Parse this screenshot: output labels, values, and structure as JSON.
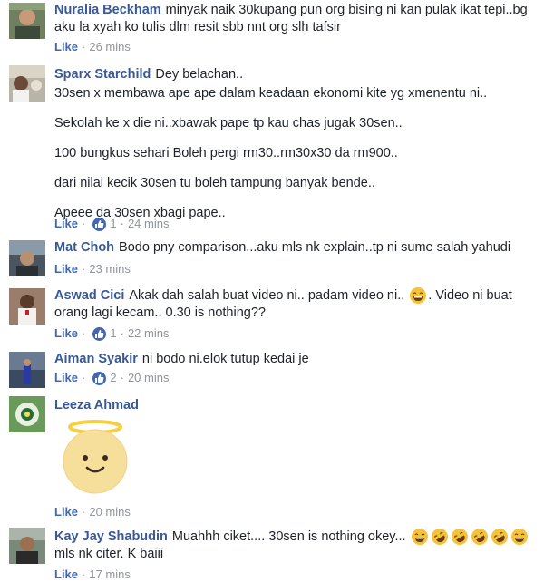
{
  "comments": [
    {
      "name": "Nuralia Beckham",
      "text": "minyak naik 30kupang pun org bising ni kan pulak ikat tepi..bg aku la xyah ko tulis dlm resit sbb nnt org slh tafsir",
      "like_label": "Like",
      "time": "26 mins"
    },
    {
      "name": "Sparx Starchild",
      "paragraphs": [
        "Dey belachan..",
        "30sen x membawa ape ape dalam keadaan ekonomi kite yg xmenentu ni..",
        "Sekolah ke x die ni..xbawak pape tp kau chas jugak 30sen..",
        "100 bungkus sehari Boleh pergi rm30..rm30x30 da rm900..",
        "dari nilai kecik 30sen tu boleh tampung banyak bende..",
        "Apeee da 30sen xbagi pape.."
      ],
      "like_label": "Like",
      "reactions": "1",
      "time": "24 mins"
    },
    {
      "name": "Mat Choh",
      "text": "Bodo pny comparison...aku mls nk explain..tp ni sume salah yahudi",
      "like_label": "Like",
      "time": "23 mins"
    },
    {
      "name": "Aswad Cici",
      "text_a": "Akak dah salah buat video ni.. padam video ni..",
      "text_b": ". Video ni buat orang lagi kecam.. 0.30 is nothing??",
      "like_label": "Like",
      "reactions": "1",
      "time": "22 mins"
    },
    {
      "name": "Aiman Syakir",
      "text": "ni bodo ni.elok tutup kedai je",
      "like_label": "Like",
      "reactions": "2",
      "time": "20 mins"
    },
    {
      "name": "Leeza Ahmad",
      "sticker": "smiling-face-with-halo",
      "like_label": "Like",
      "time": "20 mins"
    },
    {
      "name": "Kay Jay Shabudin",
      "text_a": "Muahhh ciket.... 30sen is nothing okey...",
      "text_b": "mls nk citer. K baiii",
      "like_label": "Like",
      "time": "17 mins"
    }
  ],
  "sep": "·",
  "colors": {
    "name": "#385898",
    "meta": "#90949c",
    "like_badge": "#4267b2",
    "text": "#1d2129"
  }
}
